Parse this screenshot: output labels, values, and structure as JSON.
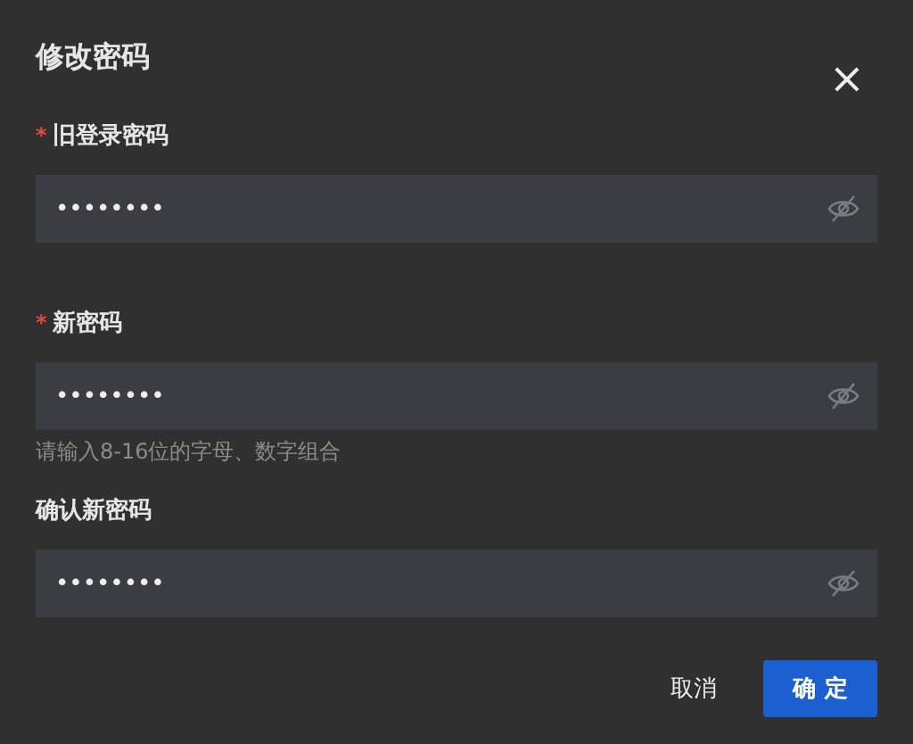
{
  "dialog": {
    "title": "修改密码",
    "close": "×"
  },
  "fields": [
    {
      "label": "旧登录密码",
      "required_mark": "*",
      "value": "••••••••"
    },
    {
      "label": "新密码",
      "required_mark": "*",
      "value": "••••••••",
      "hint": "请输入8-16位的字母、数字组合"
    },
    {
      "label": "确认新密码",
      "value": "••••••••"
    }
  ],
  "buttons": [
    {
      "label": "取消",
      "kind": "text"
    },
    {
      "label": "确 定",
      "kind": "primary"
    }
  ]
}
